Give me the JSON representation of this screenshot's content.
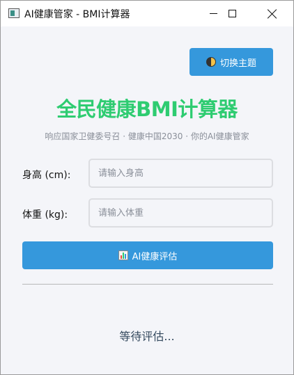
{
  "window": {
    "title": "AI健康管家 - BMI计算器"
  },
  "header": {
    "theme_button_label": "切换主题",
    "theme_icon": "half-moon-icon",
    "title": "全民健康BMI计算器",
    "subtitle": "响应国家卫健委号召 · 健康中国2030 · 你的AI健康管家",
    "title_color": "#2ecc71"
  },
  "form": {
    "height_label": "身高 (cm):",
    "height_placeholder": "请输入身高",
    "height_value": "",
    "weight_label": "体重 (kg):",
    "weight_placeholder": "请输入体重",
    "weight_value": ""
  },
  "actions": {
    "evaluate_label": "AI健康评估",
    "evaluate_icon": "bar-chart-icon",
    "accent_color": "#3598dc"
  },
  "result": {
    "status_text": "等待评估..."
  }
}
